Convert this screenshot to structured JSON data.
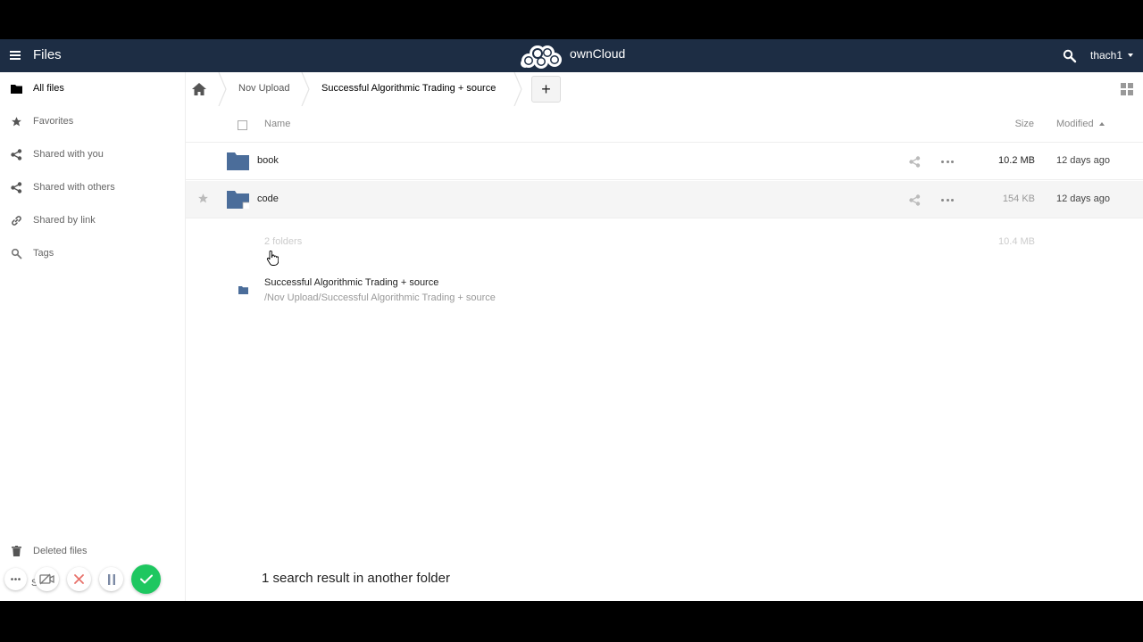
{
  "header": {
    "app_title": "Files",
    "logo_text": "ownCloud",
    "username": "thach1"
  },
  "sidebar": {
    "items": [
      {
        "label": "All files",
        "icon": "folder-icon",
        "active": true
      },
      {
        "label": "Favorites",
        "icon": "star-icon"
      },
      {
        "label": "Shared with you",
        "icon": "share-icon"
      },
      {
        "label": "Shared with others",
        "icon": "share-icon"
      },
      {
        "label": "Shared by link",
        "icon": "link-icon"
      },
      {
        "label": "Tags",
        "icon": "tag-search-icon"
      }
    ],
    "deleted_files": "Deleted files",
    "settings_partial": "S"
  },
  "breadcrumb": {
    "items": [
      "Nov Upload",
      "Successful Algorithmic Trading + source"
    ],
    "new_label": "+"
  },
  "list": {
    "columns": {
      "name": "Name",
      "size": "Size",
      "modified": "Modified"
    },
    "rows": [
      {
        "name": "book",
        "size": "10.2 MB",
        "modified": "12 days ago",
        "size_color": "#222222"
      },
      {
        "name": "code",
        "size": "154 KB",
        "modified": "12 days ago",
        "size_color": "#999999"
      }
    ],
    "summary": {
      "count": "2 folders",
      "size": "10.4 MB"
    }
  },
  "search_result": {
    "name": "Successful Algorithmic Trading + source",
    "path": "/Nov Upload/Successful Algorithmic Trading + source",
    "summary": "1 search result in another folder"
  },
  "colors": {
    "header_bg": "#1d2d44",
    "folder": "#4b6d9a",
    "confirm": "#1ec760",
    "cancel": "#e8726b"
  }
}
